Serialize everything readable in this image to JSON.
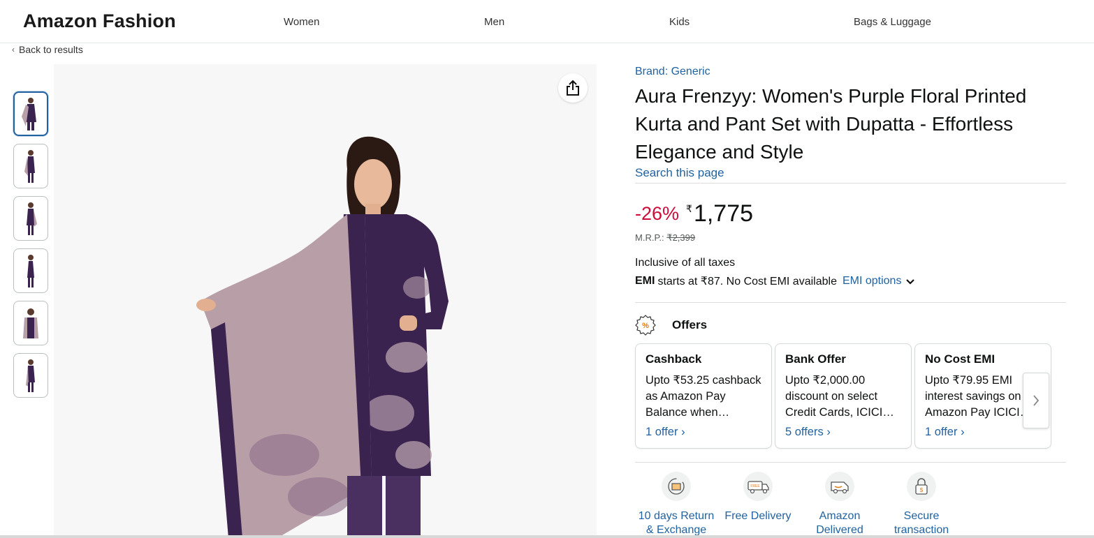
{
  "header": {
    "brand": "Amazon Fashion",
    "nav": [
      "Women",
      "Men",
      "Kids",
      "Bags & Luggage"
    ]
  },
  "back_link": "Back to results",
  "thumbnails_count": 6,
  "product": {
    "brand_link": "Brand: Generic",
    "title": "Aura Frenzyy: Women's Purple Floral Printed Kurta and Pant Set with Dupatta - Effortless Elegance and Style",
    "search_page": "Search this page",
    "discount": "-26%",
    "currency_symbol": "₹",
    "price": "1,775",
    "mrp_label": "M.R.P.:",
    "mrp_value": "₹2,399",
    "taxes": "Inclusive of all taxes",
    "emi_bold": "EMI",
    "emi_text": "starts at ₹87. No Cost EMI available",
    "emi_link": "EMI options"
  },
  "offers": {
    "heading": "Offers",
    "cards": [
      {
        "title": "Cashback",
        "body": "Upto ₹53.25 cashback as Amazon Pay Balance when…",
        "link": "1 offer ›"
      },
      {
        "title": "Bank Offer",
        "body": "Upto ₹2,000.00 discount on select Credit Cards, ICICI…",
        "link": "5 offers ›"
      },
      {
        "title": "No Cost EMI",
        "body": "Upto ₹79.95 EMI interest savings on Amazon Pay ICICI…",
        "link": "1 offer ›"
      }
    ]
  },
  "features": [
    {
      "label": "10 days Return & Exchange",
      "icon": "return-box-icon"
    },
    {
      "label": "Free Delivery",
      "icon": "free-delivery-truck-icon"
    },
    {
      "label": "Amazon Delivered",
      "icon": "amazon-van-icon"
    },
    {
      "label": "Secure transaction",
      "icon": "padlock-icon"
    }
  ],
  "colors": {
    "link": "#2162a1",
    "discount": "#cc0c39",
    "dupatta": "#b8a0a8",
    "kurta": "#3b2350"
  }
}
